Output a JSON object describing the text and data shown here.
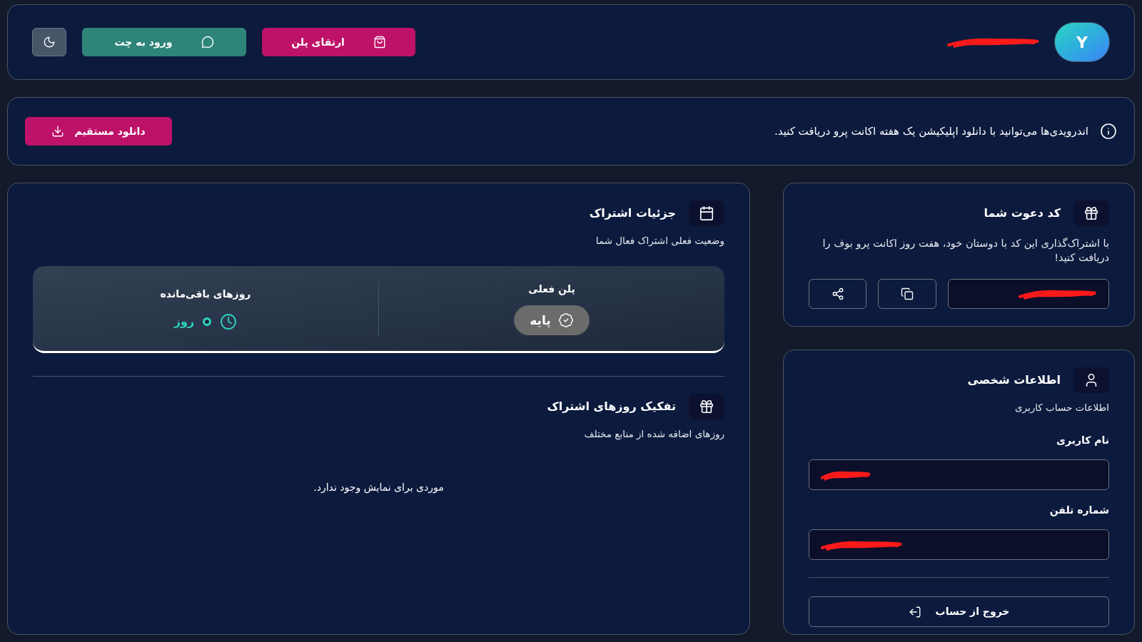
{
  "header": {
    "avatar": "Y",
    "name_redacted": true,
    "buttons": [
      {
        "kind": "upgrade",
        "label": "ارتقای پلن"
      },
      {
        "kind": "chat",
        "label": "ورود به چت"
      },
      {
        "kind": "theme"
      }
    ]
  },
  "notice": {
    "text": "اندرویدی‌ها می‌توانید با دانلود اپلیکیشن یک هفته اکانت پرو دریافت کنید.",
    "button": "دانلود مستقیم"
  },
  "subscription": {
    "title": "جزئیات اشتراک",
    "subtitle": "وضعیت فعلی اشتراک فعال شما",
    "current_plan_label": "پلن فعلی",
    "plan": "پایه",
    "remaining_label": "روزهای باقی‌مانده",
    "remaining_unit": "روز"
  },
  "breakdown": {
    "title": "تفکیک روزهای اشتراک",
    "subtitle": "روزهای اضافه شده از منابع مختلف",
    "empty_message": "موردی برای نمایش وجود ندارد."
  },
  "invite": {
    "title": "کد دعوت شما",
    "description": "با اشتراک‌گذاری این کد با دوستان خود، هفت روز اکانت پرو بوف را دریافت کنید!",
    "code_redacted": true
  },
  "personal": {
    "title": "اطلاعات شخصی",
    "subtitle": "اطلاعات حساب کاربری",
    "fields": [
      {
        "label": "نام کاربری",
        "redacted": true
      },
      {
        "label": "شماره تلفن",
        "redacted": true
      }
    ],
    "logout": "خروج از حساب"
  }
}
